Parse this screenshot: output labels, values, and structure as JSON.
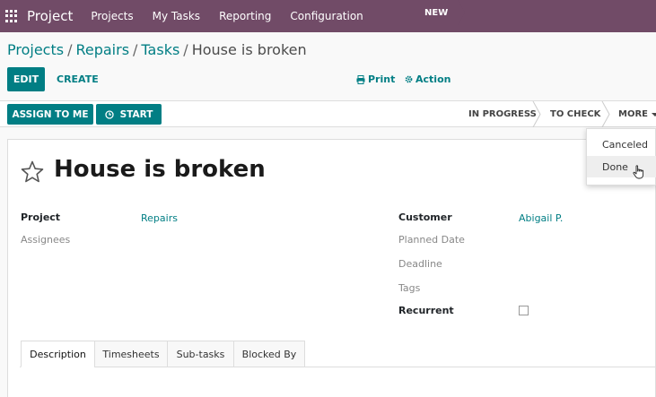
{
  "navbar": {
    "brand": "Project",
    "menu": [
      "Projects",
      "My Tasks",
      "Reporting",
      "Configuration"
    ],
    "color": "#714b67"
  },
  "breadcrumb": {
    "items": [
      "Projects",
      "Repairs",
      "Tasks"
    ],
    "current": "House is broken"
  },
  "toolbar": {
    "edit": "EDIT",
    "create": "CREATE",
    "print": "Print",
    "action": "Action"
  },
  "header_buttons": {
    "assign": "ASSIGN TO ME",
    "start": "START"
  },
  "stages": {
    "new": "NEW",
    "in_progress": "IN PROGRESS",
    "to_check": "TO CHECK",
    "more": "MORE"
  },
  "more_menu": {
    "items": [
      "Canceled",
      "Done"
    ]
  },
  "task": {
    "title": "House is broken"
  },
  "fields": {
    "project_label": "Project",
    "project_value": "Repairs",
    "assignees_label": "Assignees",
    "customer_label": "Customer",
    "customer_value": "Abigail P.",
    "planned_date_label": "Planned Date",
    "deadline_label": "Deadline",
    "tags_label": "Tags",
    "recurrent_label": "Recurrent"
  },
  "tabs": [
    "Description",
    "Timesheets",
    "Sub-tasks",
    "Blocked By"
  ],
  "colors": {
    "primary": "#017e84",
    "brand": "#714b67"
  }
}
